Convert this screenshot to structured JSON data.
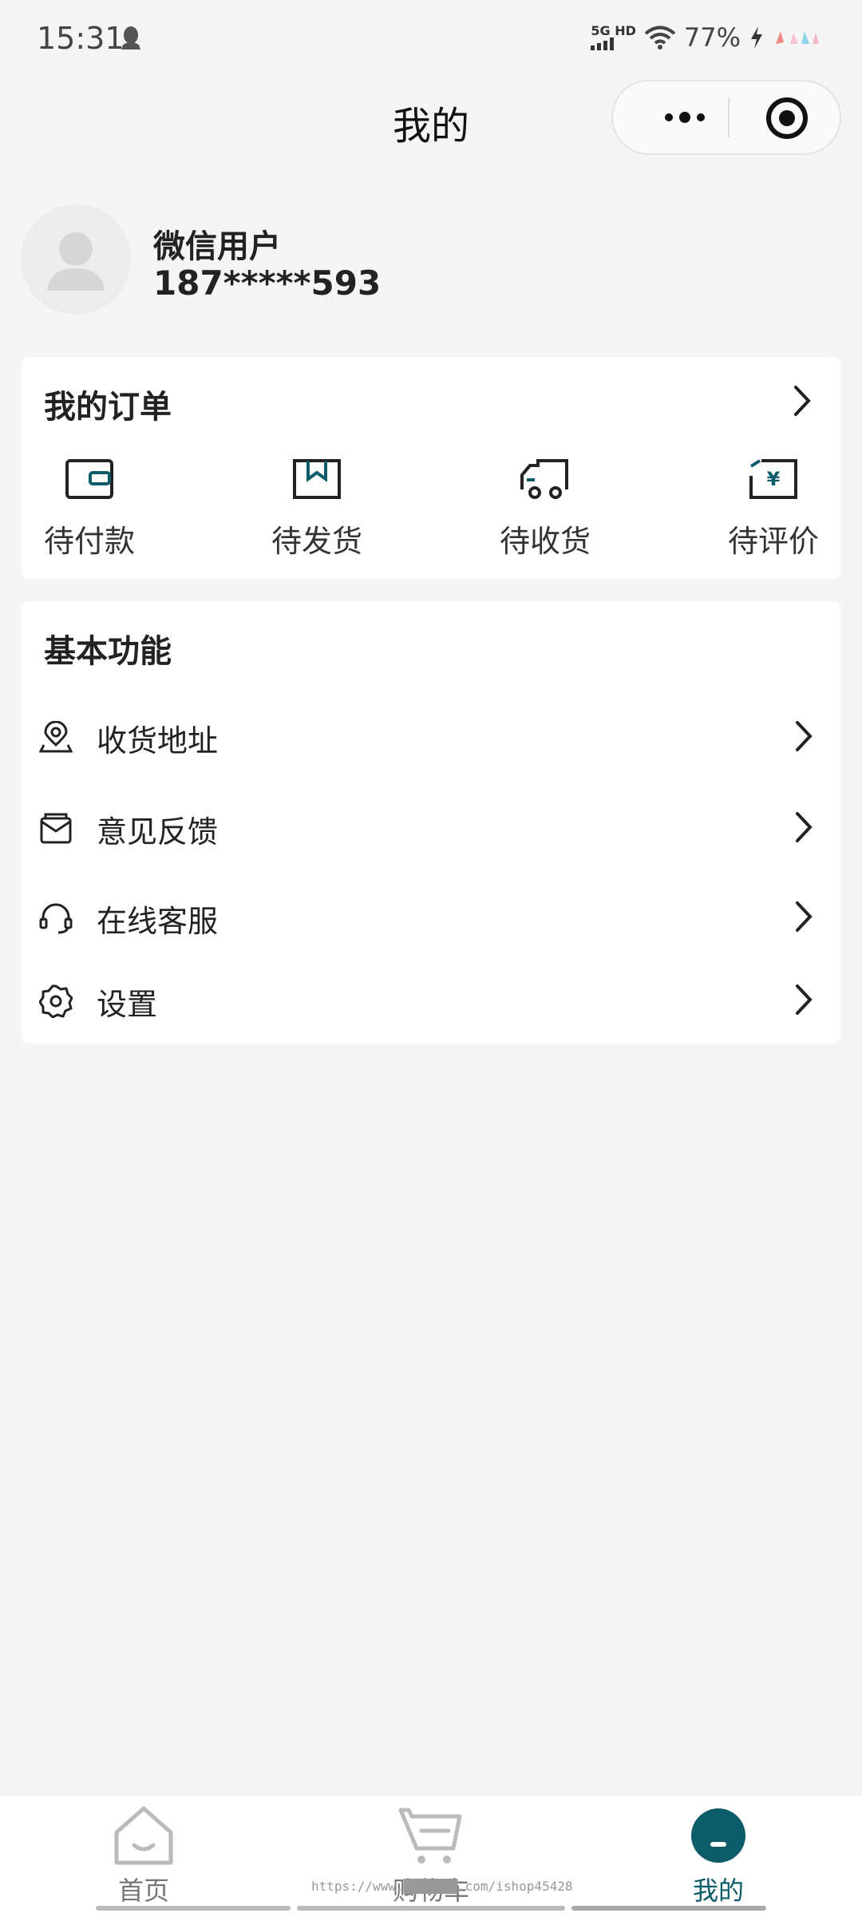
{
  "status_bar": {
    "time": "15:31",
    "network_top": "5G HD",
    "battery": "77%"
  },
  "nav": {
    "title": "我的"
  },
  "profile": {
    "name": "微信用户",
    "phone": "187*****593"
  },
  "orders": {
    "title": "我的订单",
    "items": [
      {
        "label": "待付款",
        "icon": "wallet-icon"
      },
      {
        "label": "待发货",
        "icon": "box-icon"
      },
      {
        "label": "待收货",
        "icon": "truck-icon"
      },
      {
        "label": "待评价",
        "icon": "review-yen-icon"
      }
    ]
  },
  "basic": {
    "title": "基本功能",
    "items": [
      {
        "label": "收货地址",
        "icon": "location-icon"
      },
      {
        "label": "意见反馈",
        "icon": "feedback-icon"
      },
      {
        "label": "在线客服",
        "icon": "headset-icon"
      },
      {
        "label": "设置",
        "icon": "gear-icon"
      }
    ]
  },
  "tabbar": {
    "items": [
      {
        "label": "首页",
        "icon": "home-icon"
      },
      {
        "label": "购物车",
        "icon": "cart-icon"
      },
      {
        "label": "我的",
        "icon": "profile-icon"
      }
    ],
    "active_index": 2
  },
  "watermark": "https://www.███████.com/ishop45428",
  "colors": {
    "accent": "#0d5c6a",
    "background": "#f5f5f5"
  }
}
